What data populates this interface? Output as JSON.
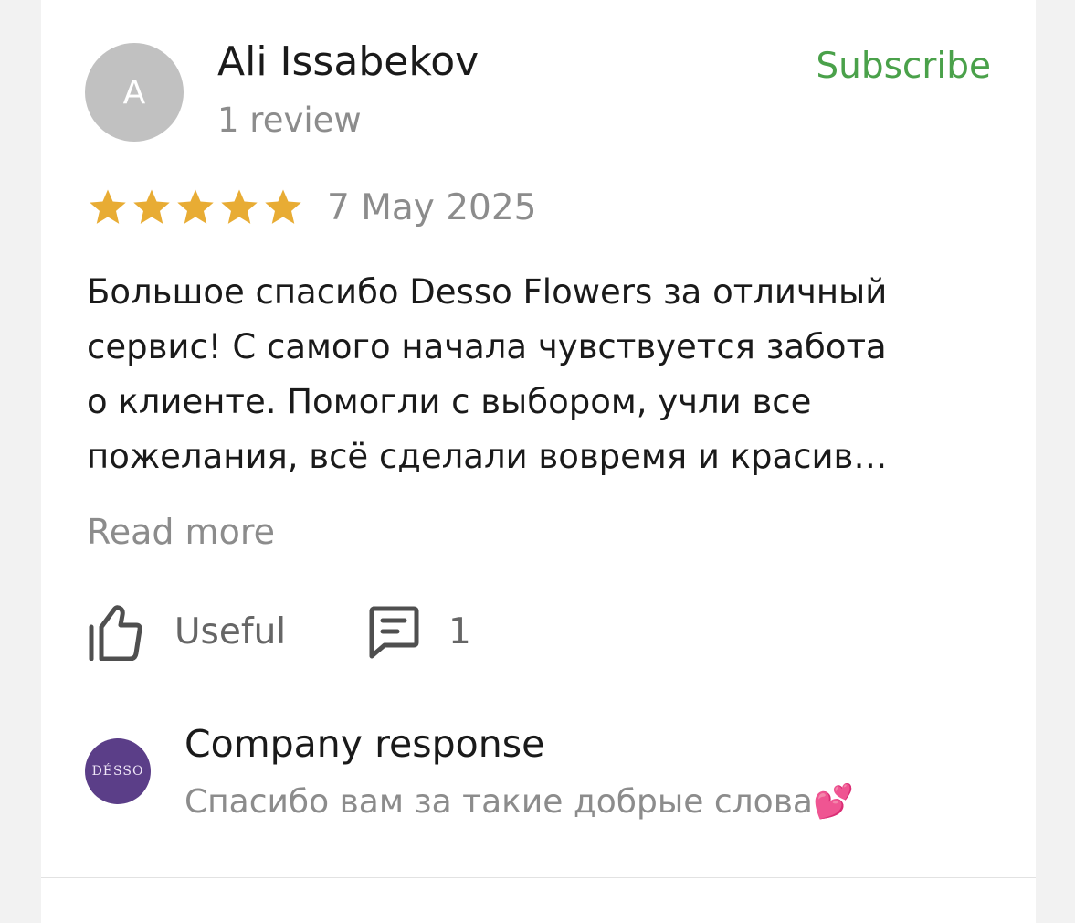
{
  "review": {
    "author": {
      "initial": "A",
      "name": "Ali Issabekov",
      "review_count": "1 review"
    },
    "subscribe_label": "Subscribe",
    "rating": 5,
    "date": "7 May 2025",
    "text": "Большое спасибо Desso Flowers за отличный\nсервис! С самого начала чувствуется забота\nо клиенте. Помогли с выбором, учли все\nпожелания, всё сделали вовремя и красив…",
    "read_more_label": "Read more",
    "useful_label": "Useful",
    "comments_count": "1"
  },
  "company_response": {
    "logo_text": "DÉSSO",
    "title": "Company response",
    "text": "Спасибо вам за такие добрые слова💕"
  },
  "colors": {
    "accent_green": "#4aa14a",
    "star": "#e8ac34",
    "company_logo_bg": "#5b3e88"
  },
  "icons": {
    "rating": "star-icon",
    "useful": "thumbs-up-icon",
    "comments": "comment-icon"
  }
}
